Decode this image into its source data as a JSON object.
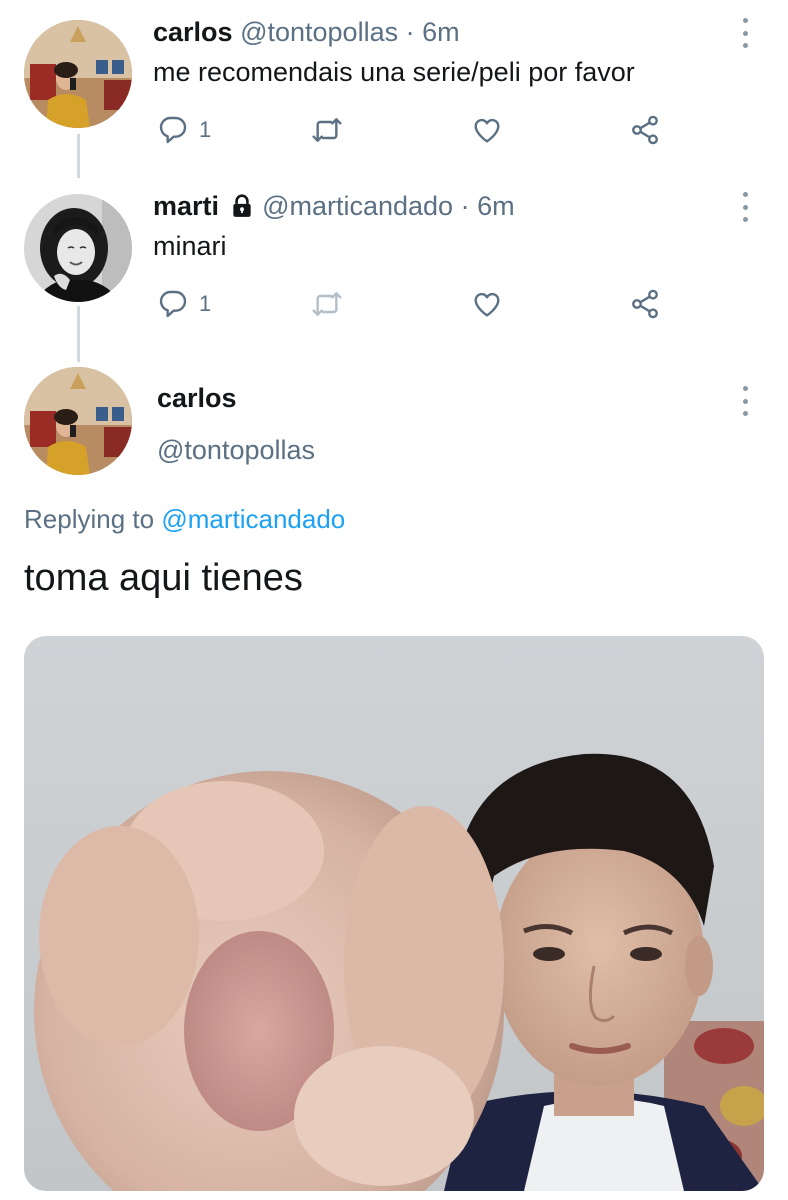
{
  "tweets": [
    {
      "name": "carlos",
      "handle": "@tontopollas",
      "time": "6m",
      "text": "me recomendais una serie/peli por favor",
      "reply_count": "1",
      "locked": false
    },
    {
      "name": "marti",
      "handle": "@marticandado",
      "time": "6m",
      "text": "minari",
      "reply_count": "1",
      "locked": true
    }
  ],
  "main": {
    "name": "carlos",
    "handle": "@tontopollas",
    "replying_prefix": "Replying to ",
    "replying_handle": "@marticandado",
    "text": "toma aqui tienes"
  },
  "separator": "·",
  "icons": [
    "reply-icon",
    "retweet-icon",
    "like-icon",
    "share-icon",
    "lock-icon",
    "more-icon"
  ],
  "colors": {
    "link": "#1da1f2",
    "muted": "#5b7083",
    "line": "#cfd9de"
  }
}
